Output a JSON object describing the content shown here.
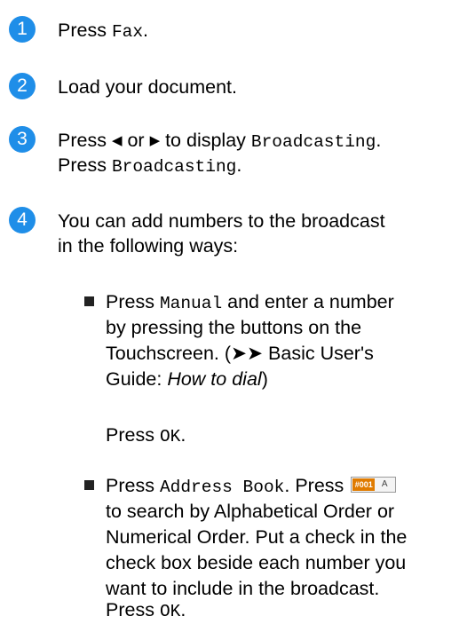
{
  "colors": {
    "step_badge": "#1f8ee8",
    "book_button_left": "#e07b00"
  },
  "steps": [
    {
      "number": "1",
      "parts": {
        "a": "Press ",
        "b": "Fax",
        "c": "."
      }
    },
    {
      "number": "2",
      "text": "Load your document."
    },
    {
      "number": "3",
      "line1": {
        "a": "Press ",
        "left_arrow": "◀",
        "or": " or ",
        "right_arrow": "▶",
        "b": " to display ",
        "c": "Broadcasting",
        "d": "."
      },
      "line2": {
        "a": "Press ",
        "b": "Broadcasting",
        "c": "."
      }
    },
    {
      "number": "4",
      "line1": "You can add numbers to the broadcast",
      "line2": "in the following ways:",
      "bullets": [
        {
          "icon": "square-bullet-icon",
          "l1a": "Press ",
          "l1b": "Manual",
          "l1c": " and enter a number",
          "l2": "by pressing the buttons on the",
          "l3a": "Touchscreen. (",
          "l3arrows": "➤➤",
          "l3b": " Basic User's",
          "l4a": "Guide: ",
          "l4b": "How to dial",
          "l4c": ")",
          "press_ok": {
            "a": "Press ",
            "b": "OK",
            "c": "."
          }
        },
        {
          "icon": "square-bullet-icon",
          "l1a": "Press ",
          "l1b": "Address Book",
          "l1c": ". Press ",
          "button_left": "#001",
          "button_right": "A",
          "l2": "to search by Alphabetical Order or",
          "l3": "Numerical Order. Put a check in the",
          "l4": "check box beside each number you",
          "l5": "want to include in the broadcast.",
          "press_ok": {
            "a": "Press ",
            "b": "OK",
            "c": "."
          }
        }
      ]
    }
  ]
}
